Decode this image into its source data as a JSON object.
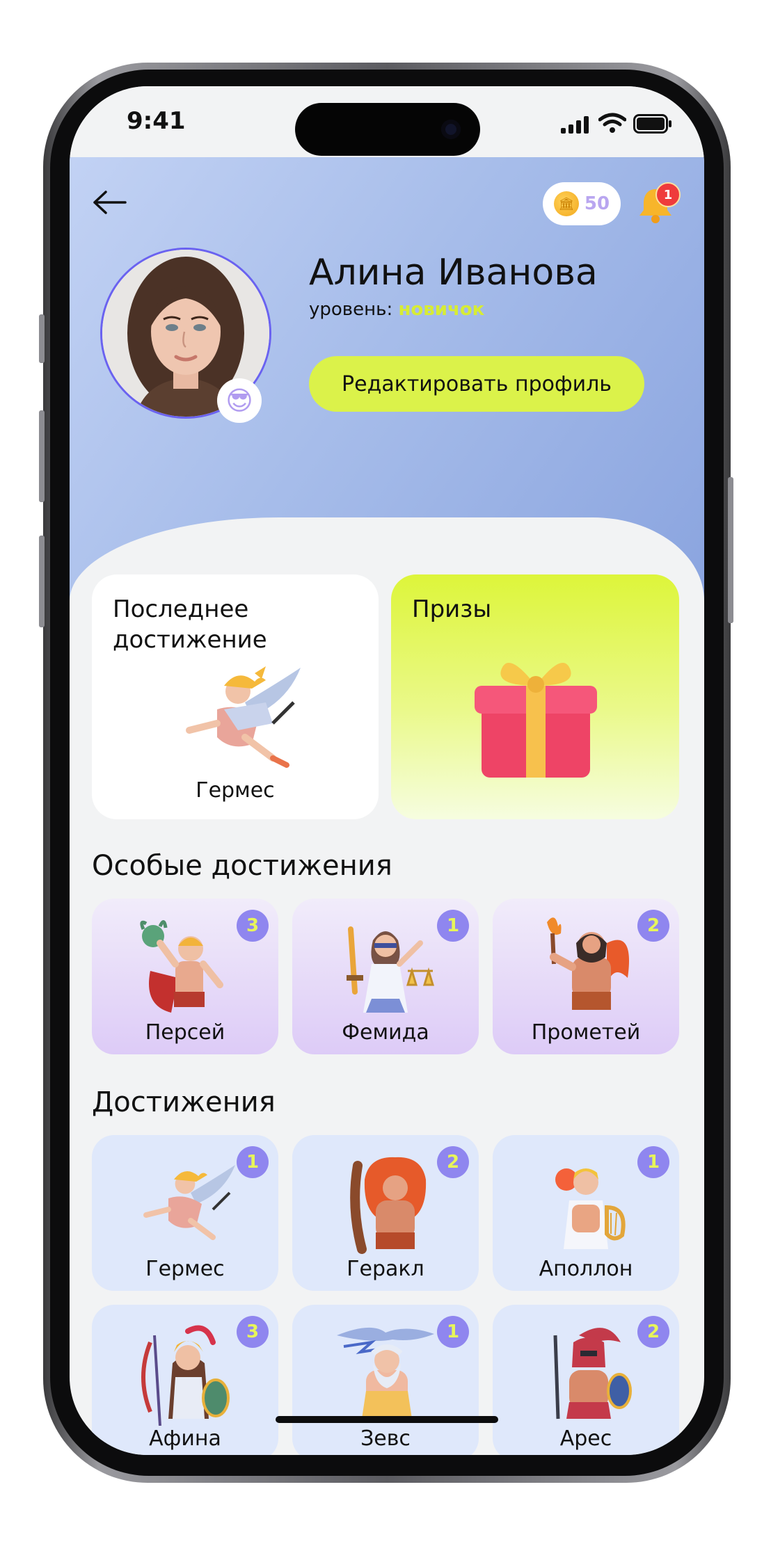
{
  "status": {
    "time": "9:41"
  },
  "header": {
    "coins": "50",
    "notifications": "1",
    "name": "Алина Иванова",
    "level_label": "уровень:",
    "level_value": "новичок",
    "edit_label": "Редактировать профиль"
  },
  "last_achievement": {
    "title_line1": "Последнее",
    "title_line2": "достижение",
    "caption": "Гермес"
  },
  "prizes": {
    "title": "Призы"
  },
  "special": {
    "title": "Особые достижения",
    "items": [
      {
        "label": "Персей",
        "count": "3"
      },
      {
        "label": "Фемида",
        "count": "1"
      },
      {
        "label": "Прометей",
        "count": "2"
      }
    ]
  },
  "achievements": {
    "title": "Достижения",
    "items": [
      {
        "label": "Гермес",
        "count": "1"
      },
      {
        "label": "Геракл",
        "count": "2"
      },
      {
        "label": "Аполлон",
        "count": "1"
      },
      {
        "label": "Афина",
        "count": "3"
      },
      {
        "label": "Зевс",
        "count": "1"
      },
      {
        "label": "Арес",
        "count": "2"
      }
    ]
  },
  "colors": {
    "accent": "#dbf24a",
    "badge": "#8f86ef",
    "notification": "#ef3b3b"
  }
}
